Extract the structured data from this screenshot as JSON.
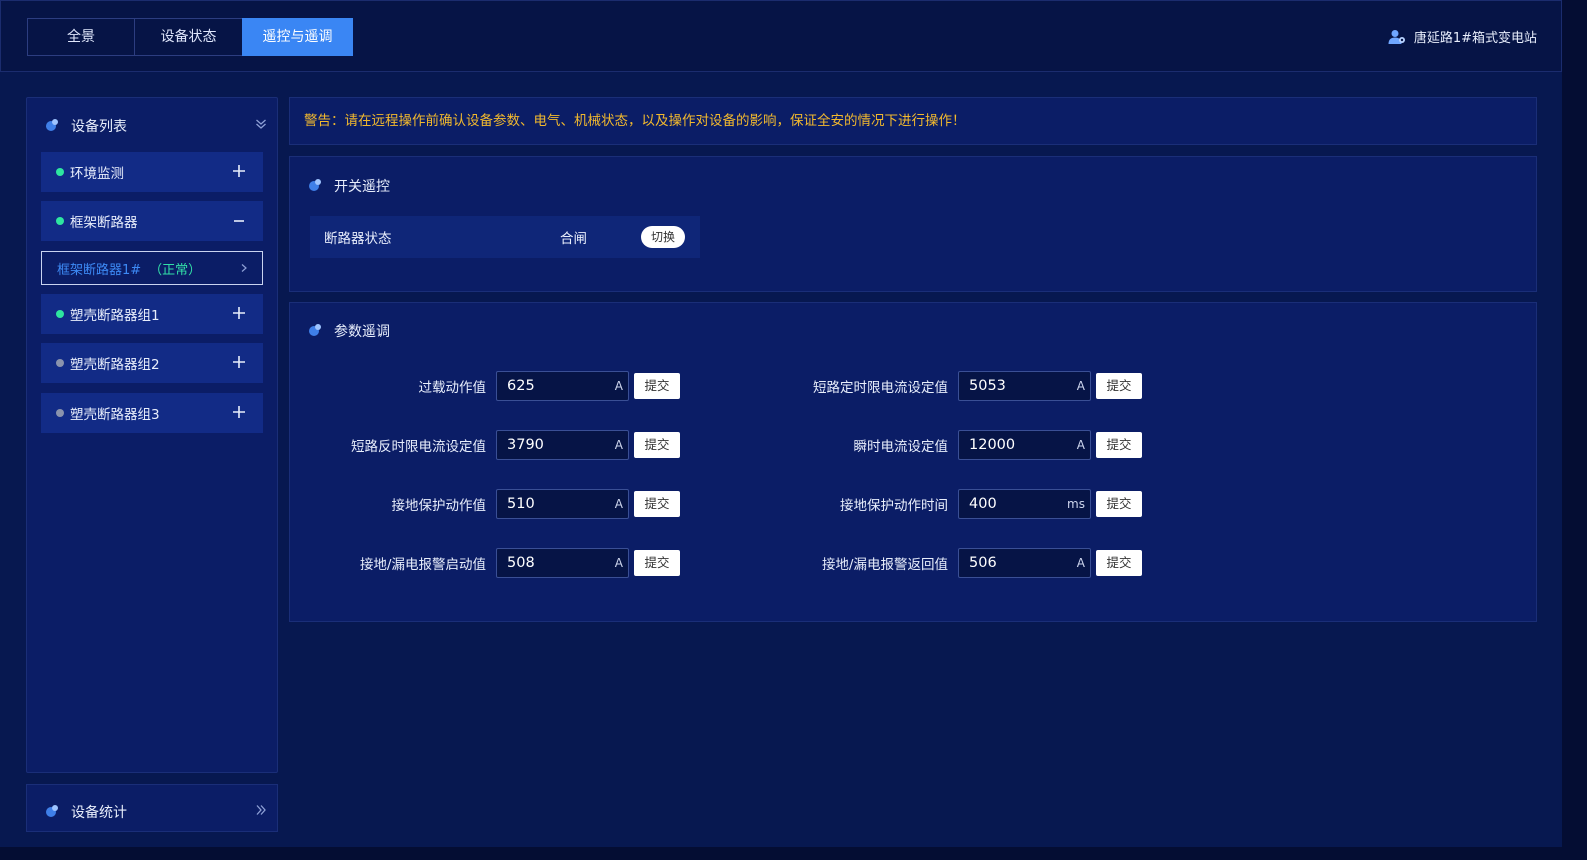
{
  "header": {
    "tabs": [
      {
        "label": "全景",
        "active": false
      },
      {
        "label": "设备状态",
        "active": false
      },
      {
        "label": "遥控与遥调",
        "active": true
      }
    ],
    "station_name": "唐延路1#箱式变电站",
    "station_icon": "user-location-icon"
  },
  "sidebar": {
    "title": "设备列表",
    "groups": [
      {
        "label": "环境监测",
        "status_color": "#2ee6a0",
        "expander": "+"
      },
      {
        "label": "框架断路器",
        "status_color": "#2ee6a0",
        "expander": "−"
      },
      {
        "label": "塑壳断路器组1",
        "status_color": "#2ee6a0",
        "expander": "+"
      },
      {
        "label": "塑壳断路器组2",
        "status_color": "#8a93ad",
        "expander": "+"
      },
      {
        "label": "塑壳断路器组3",
        "status_color": "#8a93ad",
        "expander": "+"
      }
    ],
    "selected_item": {
      "name": "框架断路器1#",
      "status": "（正常）"
    },
    "stats_title": "设备统计"
  },
  "warning": {
    "text": "警告：请在远程操作前确认设备参数、电气、机械状态，以及操作对设备的影响，保证全安的情况下进行操作！"
  },
  "switch_panel": {
    "title": "开关遥控",
    "label": "断路器状态",
    "value": "合闸",
    "button": "切换"
  },
  "param_panel": {
    "title": "参数遥调",
    "submit_label": "提交",
    "params": [
      {
        "label": "过载动作值",
        "value": "625",
        "unit": "A"
      },
      {
        "label": "短路定时限电流设定值",
        "value": "5053",
        "unit": "A"
      },
      {
        "label": "短路反时限电流设定值",
        "value": "3790",
        "unit": "A"
      },
      {
        "label": "瞬时电流设定值",
        "value": "12000",
        "unit": "A"
      },
      {
        "label": "接地保护动作值",
        "value": "510",
        "unit": "A"
      },
      {
        "label": "接地保护动作时间",
        "value": "400",
        "unit": "ms"
      },
      {
        "label": "接地/漏电报警启动值",
        "value": "508",
        "unit": "A"
      },
      {
        "label": "接地/漏电报警返回值",
        "value": "506",
        "unit": "A"
      }
    ]
  },
  "colors": {
    "background": "#071850",
    "panel": "#0b1d66",
    "accent": "#3a86f4",
    "warning": "#f2b92e",
    "status_normal": "#2ee6a0"
  }
}
